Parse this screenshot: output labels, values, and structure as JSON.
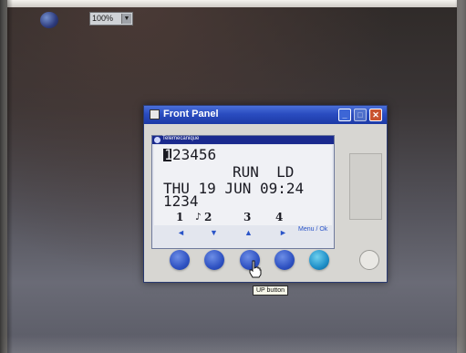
{
  "toolbar": {
    "icon": "globe-icon",
    "zoom_value": "100%",
    "zoom_arrow": "dropdown-arrow-icon"
  },
  "window": {
    "title": "Front Panel",
    "buttons": [
      "minimize",
      "maximize",
      "close"
    ]
  },
  "display": {
    "header_title": "Telemecanique",
    "cursor_digit": "1",
    "line1": "23456",
    "line2": "RUN  LD",
    "line3": "THU 19 JUN 09:24",
    "line4": "1234",
    "numbers": [
      "1",
      "2",
      "3",
      "4"
    ],
    "note_symbol": "♪",
    "arrows": [
      "◄",
      "▼",
      "▲",
      "►"
    ],
    "menu_label": "Menu / Ok"
  },
  "buttons": {
    "left": "left-button",
    "down": "down-button",
    "up": "up-button",
    "right": "right-button",
    "menu": "menu-ok-button",
    "off": "inactive-button"
  },
  "tooltip": {
    "text": "UP button"
  },
  "colors": {
    "titlebar": "#2a4cc0",
    "button_blue": "#2f52c2",
    "button_menu": "#1f8fc8",
    "arrow_blue": "#2b55c8"
  }
}
